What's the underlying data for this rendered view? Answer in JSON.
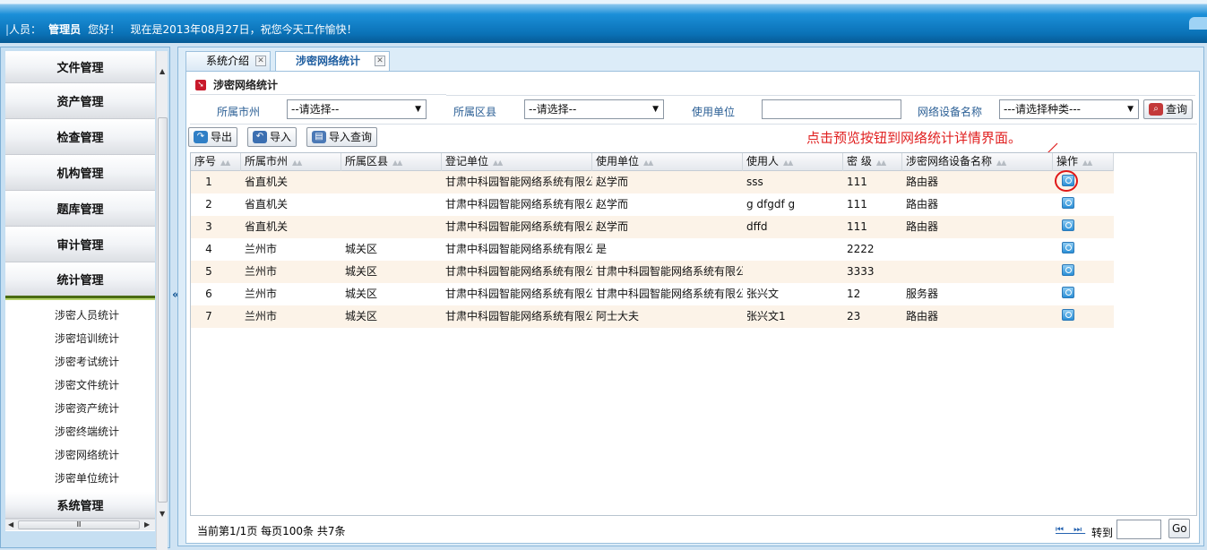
{
  "header": {
    "user_label": "人员：",
    "user_name": "管理员",
    "greeting": "您好！",
    "date_text": "现在是2013年08月27日，祝您今天工作愉快！"
  },
  "sidebar": {
    "menus": [
      {
        "label": "文件管理"
      },
      {
        "label": "资产管理"
      },
      {
        "label": "检查管理"
      },
      {
        "label": "机构管理"
      },
      {
        "label": "题库管理"
      },
      {
        "label": "审计管理"
      },
      {
        "label": "统计管理"
      }
    ],
    "submenu": [
      {
        "label": "涉密人员统计"
      },
      {
        "label": "涉密培训统计"
      },
      {
        "label": "涉密考试统计"
      },
      {
        "label": "涉密文件统计"
      },
      {
        "label": "涉密资产统计"
      },
      {
        "label": "涉密终端统计"
      },
      {
        "label": "涉密网络统计"
      },
      {
        "label": "涉密单位统计"
      }
    ],
    "last_menu": "系统管理",
    "collapse_label": "«",
    "hscroll_grip": "Ⅲ"
  },
  "tabs": [
    {
      "label": "系统介绍"
    },
    {
      "label": "涉密网络统计"
    }
  ],
  "panel": {
    "title": "涉密网络统计"
  },
  "filters": {
    "city_label": "所属市州",
    "city_value": "--请选择--",
    "district_label": "所属区县",
    "district_value": "--请选择--",
    "unit_label": "使用单位",
    "unit_value": "",
    "device_label": "网络设备名称",
    "device_value": "---请选择种类---",
    "query_button": "查询"
  },
  "toolbar": {
    "export": "导出",
    "import": "导入",
    "import_query": "导入查询"
  },
  "annotation": "点击预览按钮到网络统计详情界面。",
  "grid": {
    "columns": [
      "序号",
      "所属市州",
      "所属区县",
      "登记单位",
      "使用单位",
      "使用人",
      "密 级",
      "涉密网络设备名称",
      "操作"
    ],
    "rows": [
      {
        "no": "1",
        "city": "省直机关",
        "district": "",
        "reg_unit": "甘肃中科园智能网络系统有限公",
        "use_unit": "赵学而",
        "user": "sss",
        "level": "111",
        "device": "路由器"
      },
      {
        "no": "2",
        "city": "省直机关",
        "district": "",
        "reg_unit": "甘肃中科园智能网络系统有限公",
        "use_unit": "赵学而",
        "user": "g dfgdf g",
        "level": "111",
        "device": "路由器"
      },
      {
        "no": "3",
        "city": "省直机关",
        "district": "",
        "reg_unit": "甘肃中科园智能网络系统有限公",
        "use_unit": "赵学而",
        "user": "dffd",
        "level": "111",
        "device": "路由器"
      },
      {
        "no": "4",
        "city": "兰州市",
        "district": "城关区",
        "reg_unit": "甘肃中科园智能网络系统有限公",
        "use_unit": "是",
        "user": "",
        "level": "2222",
        "device": ""
      },
      {
        "no": "5",
        "city": "兰州市",
        "district": "城关区",
        "reg_unit": "甘肃中科园智能网络系统有限公",
        "use_unit": "甘肃中科园智能网络系统有限公",
        "user": "",
        "level": "3333",
        "device": ""
      },
      {
        "no": "6",
        "city": "兰州市",
        "district": "城关区",
        "reg_unit": "甘肃中科园智能网络系统有限公",
        "use_unit": "甘肃中科园智能网络系统有限公",
        "user": "张兴文",
        "level": "12",
        "device": "服务器"
      },
      {
        "no": "7",
        "city": "兰州市",
        "district": "城关区",
        "reg_unit": "甘肃中科园智能网络系统有限公",
        "use_unit": "阿士大夫",
        "user": "张兴文1",
        "level": "23",
        "device": "路由器"
      }
    ]
  },
  "pager": {
    "info": "当前第1/1页  每页100条  共7条",
    "nav": "⏮ ⏭",
    "goto_label": "转到",
    "go_button": "Go"
  },
  "colors": {
    "header_blue": "#0a71b6",
    "annotation_red": "#e02020",
    "row_alt": "#fcf3e8"
  }
}
